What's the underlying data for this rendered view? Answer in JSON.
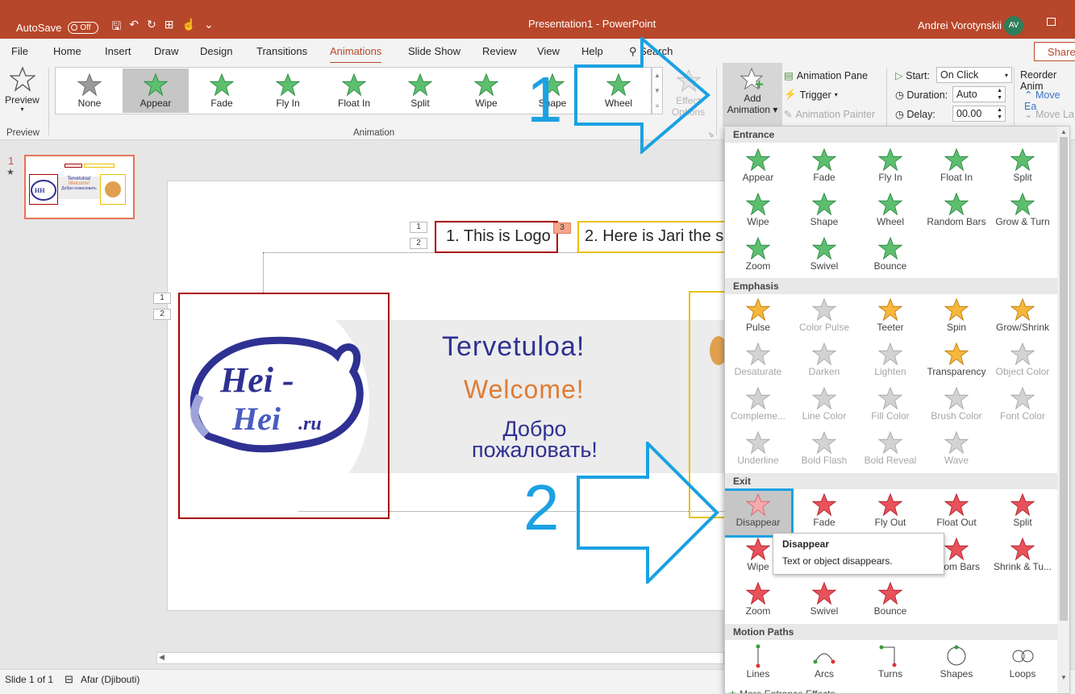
{
  "titlebar": {
    "autosave_label": "AutoSave",
    "autosave_state": "Off",
    "title": "Presentation1  -  PowerPoint",
    "user": "Andrei Vorotynskii",
    "user_initials": "AV",
    "bg_color": "#b7472a"
  },
  "tabs": [
    {
      "label": "File"
    },
    {
      "label": "Home"
    },
    {
      "label": "Insert"
    },
    {
      "label": "Draw"
    },
    {
      "label": "Design"
    },
    {
      "label": "Transitions"
    },
    {
      "label": "Animations"
    },
    {
      "label": "Slide Show"
    },
    {
      "label": "Review"
    },
    {
      "label": "View"
    },
    {
      "label": "Help"
    },
    {
      "label": "Search"
    }
  ],
  "share_label": "Share",
  "ribbon": {
    "preview_label": "Preview",
    "preview_group": "Preview",
    "animation_group": "Animation",
    "gallery": [
      {
        "label": "None",
        "color": "gray"
      },
      {
        "label": "Appear",
        "color": "green"
      },
      {
        "label": "Fade",
        "color": "green"
      },
      {
        "label": "Fly In",
        "color": "green"
      },
      {
        "label": "Float In",
        "color": "green"
      },
      {
        "label": "Split",
        "color": "green"
      },
      {
        "label": "Wipe",
        "color": "green"
      },
      {
        "label": "Shape",
        "color": "green"
      },
      {
        "label": "Wheel",
        "color": "green"
      }
    ],
    "effect_options_1": "Effect",
    "effect_options_2": "Options",
    "add_animation_1": "Add",
    "add_animation_2": "Animation",
    "animation_pane": "Animation Pane",
    "trigger": "Trigger",
    "animation_painter": "Animation Painter",
    "start_label": "Start:",
    "start_value": "On Click",
    "duration_label": "Duration:",
    "duration_value": "Auto",
    "delay_label": "Delay:",
    "delay_value": "00.00",
    "reorder_label": "Reorder Anim",
    "move_earlier": "Move Ea",
    "move_later": "Move La"
  },
  "slides_pane": {
    "slide_number": "1",
    "thumb_line1": "Tervetuloa!",
    "thumb_line2": "Welcome!"
  },
  "slide": {
    "order_tags": [
      "1",
      "2",
      "1",
      "2",
      "3"
    ],
    "callout1": "1. This is Logo",
    "callout2": "2. Here is Jari the s",
    "logo_line1": "Hei -",
    "logo_line2": "Hei",
    "logo_suffix": ".ru",
    "greet_fi": "Tervetuloa!",
    "greet_en": "Welcome!",
    "greet_ru1": "Добро",
    "greet_ru2": "пожаловать!"
  },
  "statusbar": {
    "slide_info": "Slide 1 of 1",
    "language": "Afar (Djibouti)"
  },
  "menu": {
    "entrance_header": "Entrance",
    "entrance": [
      "Appear",
      "Fade",
      "Fly In",
      "Float In",
      "Split",
      "Wipe",
      "Shape",
      "Wheel",
      "Random Bars",
      "Grow & Turn",
      "Zoom",
      "Swivel",
      "Bounce"
    ],
    "emphasis_header": "Emphasis",
    "emphasis": [
      "Pulse",
      "Color Pulse",
      "Teeter",
      "Spin",
      "Grow/Shrink",
      "Desaturate",
      "Darken",
      "Lighten",
      "Transparency",
      "Object Color",
      "Compleme...",
      "Line Color",
      "Fill Color",
      "Brush Color",
      "Font Color",
      "Underline",
      "Bold Flash",
      "Bold Reveal",
      "Wave"
    ],
    "exit_header": "Exit",
    "exit": [
      "Disappear",
      "Fade",
      "Fly Out",
      "Float Out",
      "Split",
      "Wipe",
      "",
      "",
      "ndom Bars",
      "Shrink & Tu...",
      "Zoom",
      "Swivel",
      "Bounce"
    ],
    "motion_header": "Motion Paths",
    "motion": [
      "Lines",
      "Arcs",
      "Turns",
      "Shapes",
      "Loops"
    ],
    "more_entrance": "More Entrance Effects..."
  },
  "tooltip": {
    "title": "Disappear",
    "text": "Text or object disappears."
  },
  "annotations": {
    "step1": "1",
    "step2": "2",
    "color": "#1ba1e2"
  }
}
